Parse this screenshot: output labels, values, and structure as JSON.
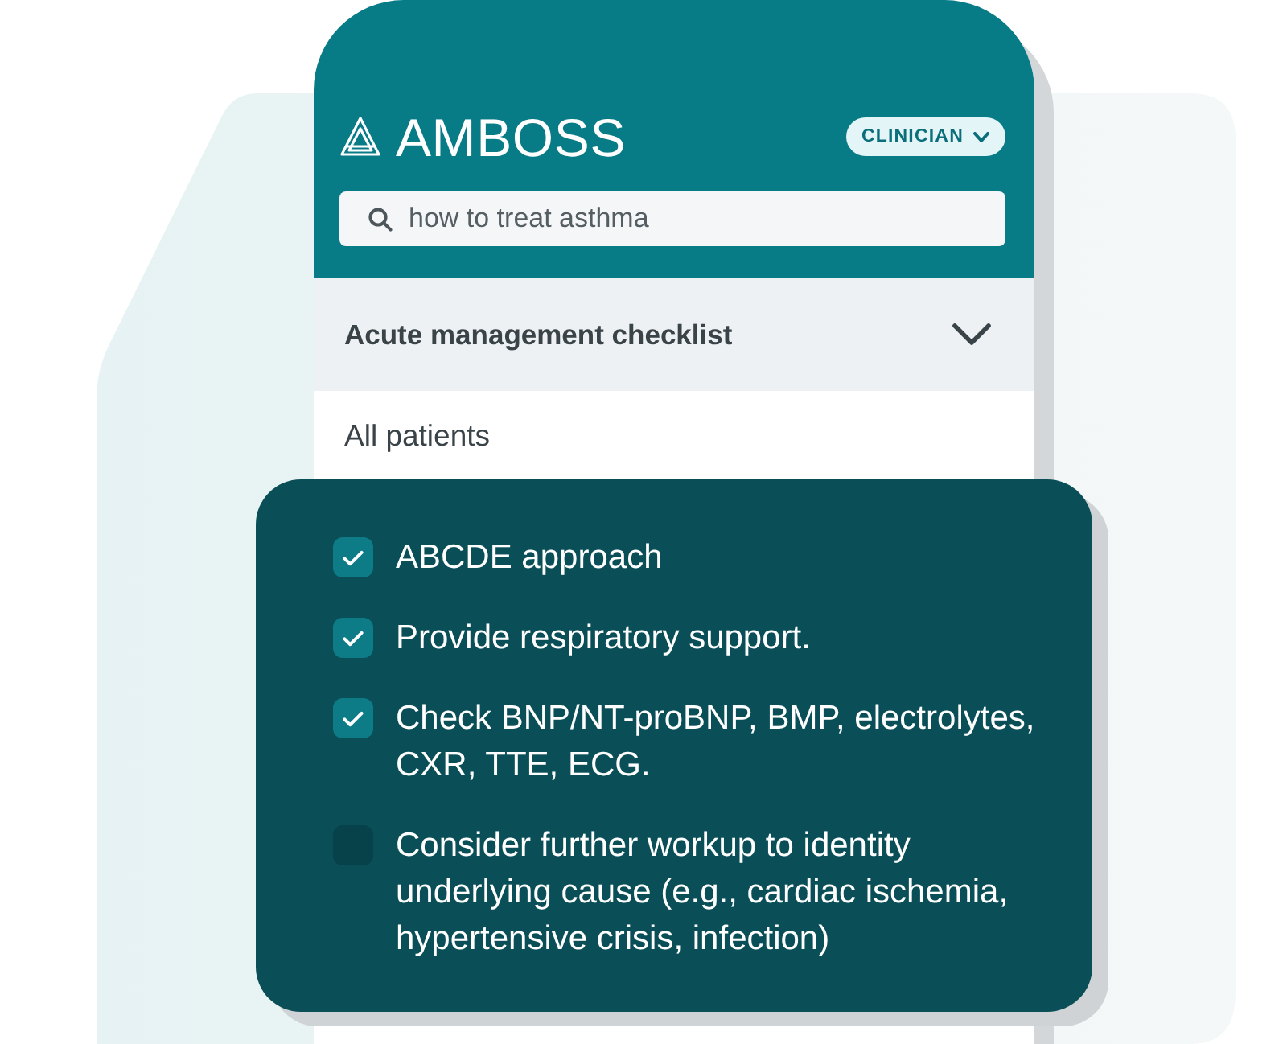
{
  "header": {
    "logo": "AMBOSS",
    "role_menu": {
      "label": "CLINICIAN"
    },
    "search": {
      "value": "how to treat asthma"
    }
  },
  "section": {
    "title": "Acute management checklist",
    "subtitle": "All patients"
  },
  "checklist": [
    {
      "text": "ABCDE approach",
      "checked": true
    },
    {
      "text": "Provide respiratory support.",
      "checked": true
    },
    {
      "text": "Check BNP/NT-proBNP, BMP, electrolytes, CXR, TTE, ECG.",
      "checked": true
    },
    {
      "text": "Consider further workup to identity underlying cause (e.g., cardiac ischemia, hypertensive crisis, infection)",
      "checked": false
    }
  ]
}
